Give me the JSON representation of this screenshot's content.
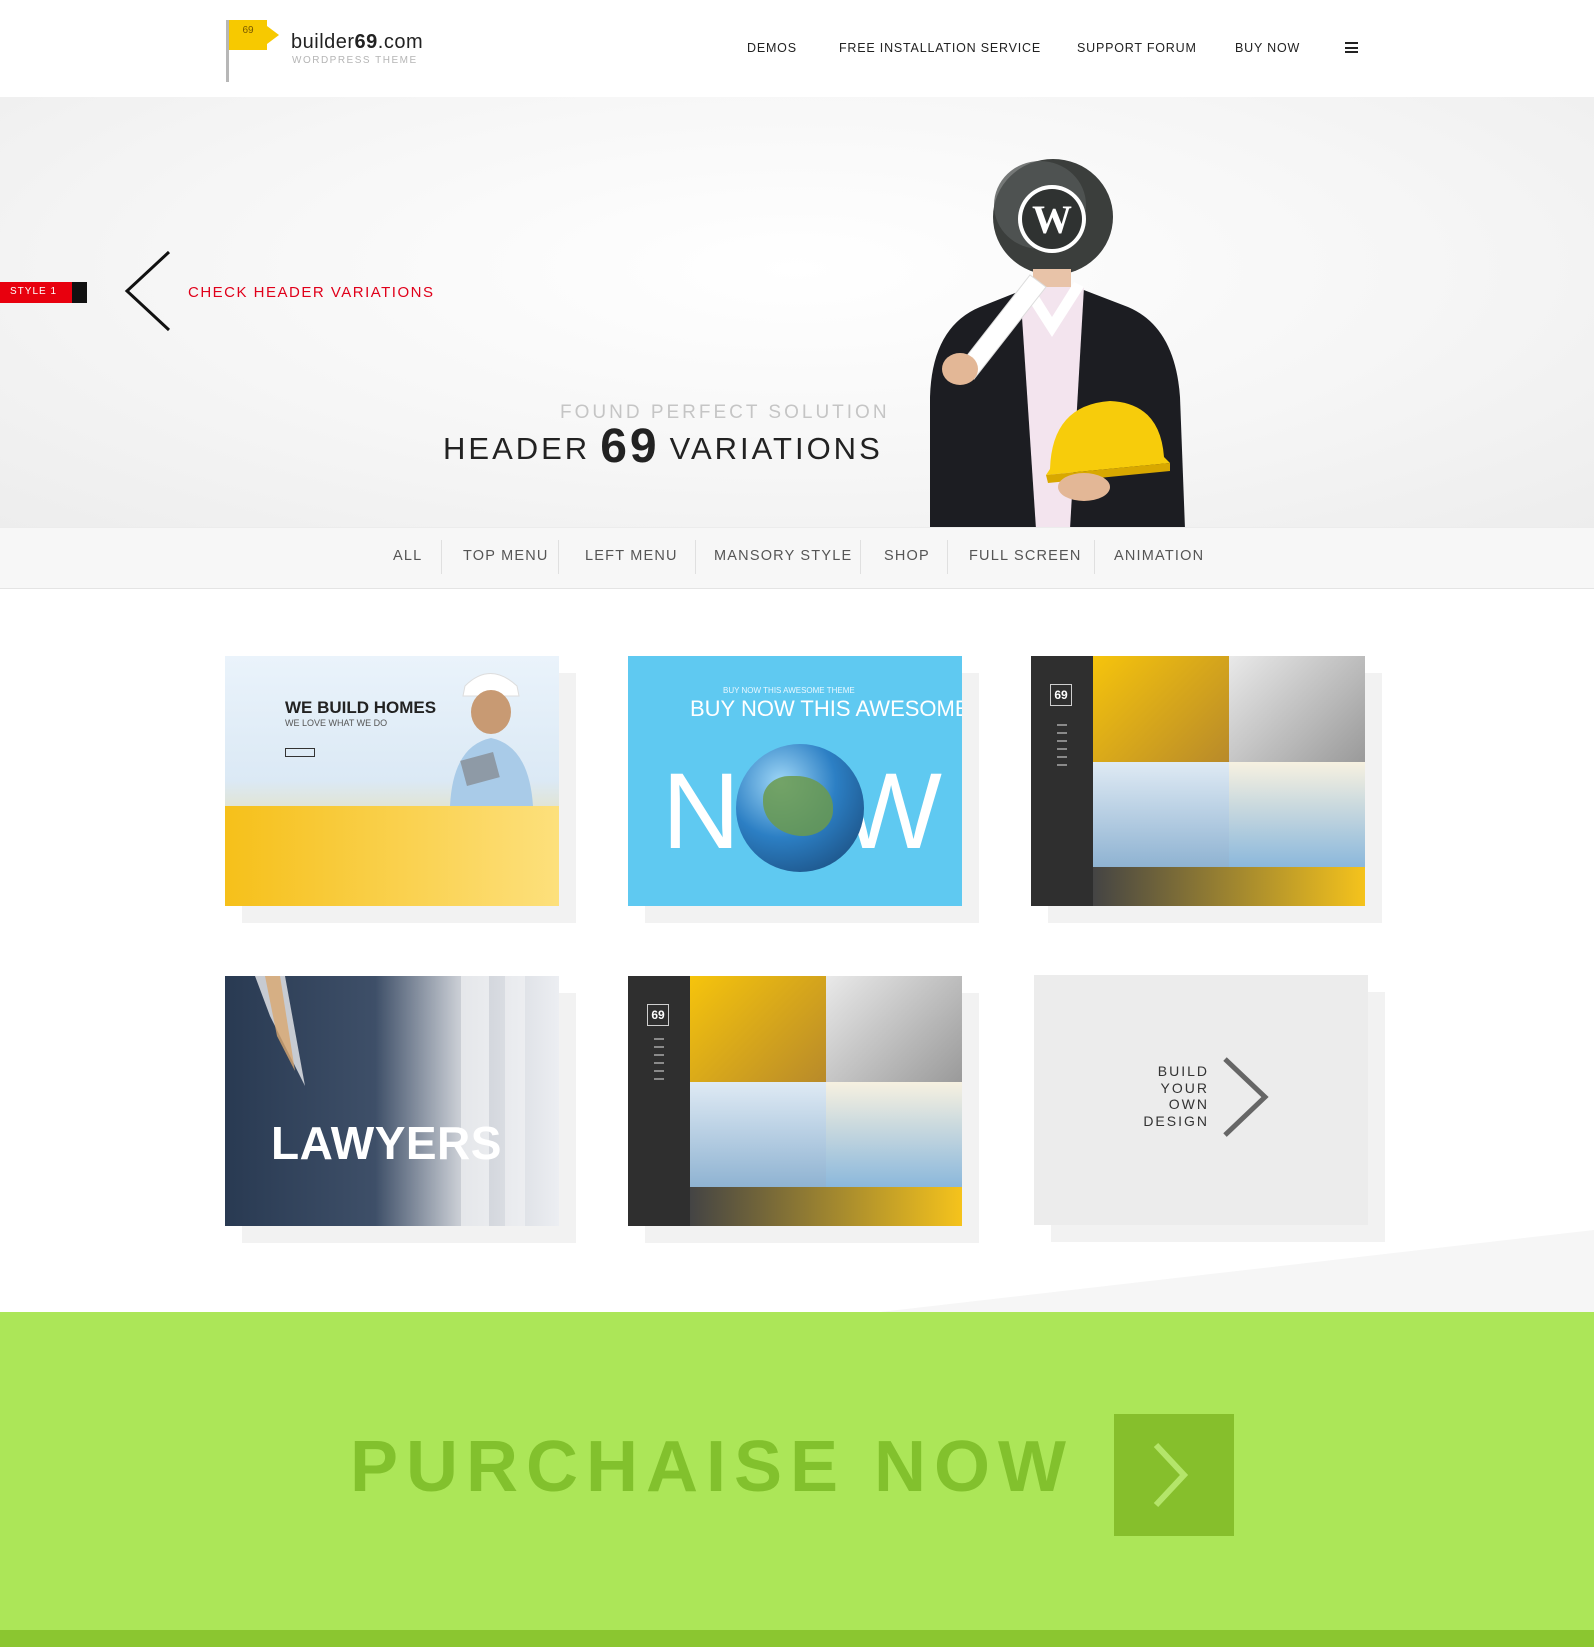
{
  "logo": {
    "flag_text": "69",
    "name_prefix": "builder",
    "name_bold": "69",
    "name_suffix": ".com",
    "subtitle": "WORDPRESS THEME"
  },
  "nav": {
    "items": [
      "DEMOS",
      "FREE INSTALLATION SERVICE",
      "SUPPORT FORUM",
      "BUY NOW"
    ],
    "menu_icon": "hamburger-icon"
  },
  "hero": {
    "style_tag": "STYLE 1",
    "check_label": "CHECK HEADER VARIATIONS",
    "subtitle": "FOUND PERFECT SOLUTION",
    "title_left": "HEADER",
    "title_number": "69",
    "title_right": "VARIATIONS",
    "logo_icon": "wordpress-logo-icon"
  },
  "filters": [
    "ALL",
    "TOP MENU",
    "LEFT MENU",
    "MANSORY STYLE",
    "SHOP",
    "FULL SCREEN",
    "ANIMATION"
  ],
  "cards": {
    "c1": {
      "title": "WE BUILD HOMES",
      "subtitle": "WE LOVE WHAT WE DO"
    },
    "c2": {
      "small": "BUY NOW THIS AWESOME THEME",
      "big": "BUY NOW THIS AWESOME",
      "huge": "NOW"
    },
    "c3": {
      "badge": "69"
    },
    "c4": {
      "title": "LAWYERS"
    },
    "c5": {
      "badge": "69"
    },
    "c6": {
      "line1": "BUILD",
      "line2": "YOUR",
      "line3": "OWN",
      "line4": "DESIGN"
    }
  },
  "purchase": {
    "label": "PURCHAISE NOW"
  },
  "colors": {
    "accent_red": "#e0001a",
    "brand_yellow": "#f7c900",
    "purchase_green": "#ace658",
    "purchase_text": "#82c12d",
    "purchase_button": "#86bf2c"
  }
}
